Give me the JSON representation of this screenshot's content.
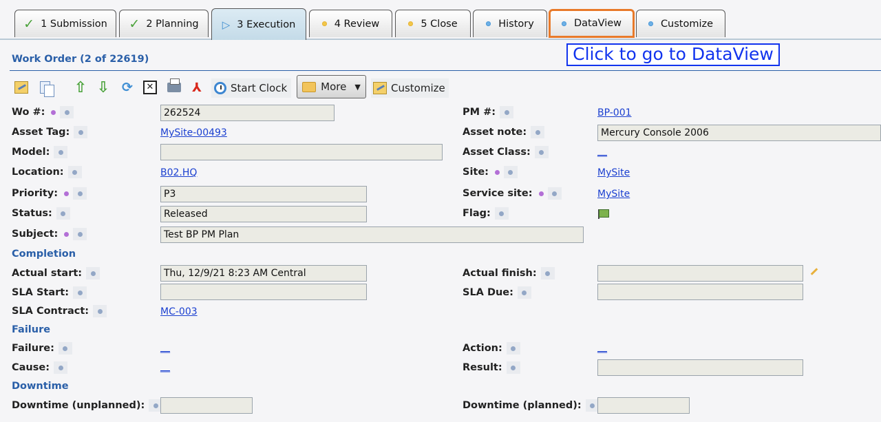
{
  "tabs": [
    {
      "label": "1 Submission",
      "status": "done"
    },
    {
      "label": "2 Planning",
      "status": "done"
    },
    {
      "label": "3 Execution",
      "status": "current"
    },
    {
      "label": "4 Review",
      "status": "pending"
    },
    {
      "label": "5 Close",
      "status": "pending"
    },
    {
      "label": "History",
      "status": "info"
    },
    {
      "label": "DataView",
      "status": "info"
    },
    {
      "label": "Customize",
      "status": "info"
    }
  ],
  "header": {
    "title": "Work Order (2 of 22619)",
    "callout": "Click to go to DataView"
  },
  "toolbar": {
    "start_clock_label": "Start Clock",
    "more_label": "More",
    "customize_label": "Customize"
  },
  "form": {
    "wo_label": "Wo #:",
    "wo_value": "262524",
    "pm_label": "PM #:",
    "pm_value": "BP-001",
    "asset_tag_label": "Asset Tag:",
    "asset_tag_value": "MySite-00493",
    "asset_note_label": "Asset note:",
    "asset_note_value": "Mercury Console 2006",
    "model_label": "Model:",
    "model_value": "",
    "asset_class_label": "Asset Class:",
    "asset_class_value": "__",
    "location_label": "Location:",
    "location_value": "B02.HQ",
    "site_label": "Site:",
    "site_value": "MySite",
    "priority_label": "Priority:",
    "priority_value": "P3",
    "service_site_label": "Service site:",
    "service_site_value": "MySite",
    "status_label": "Status:",
    "status_value": "Released",
    "flag_label": "Flag:",
    "subject_label": "Subject:",
    "subject_value": "Test BP PM Plan"
  },
  "completion": {
    "section": "Completion",
    "actual_start_label": "Actual start:",
    "actual_start_value": "Thu, 12/9/21 8:23 AM Central",
    "actual_finish_label": "Actual finish:",
    "actual_finish_value": "",
    "sla_start_label": "SLA Start:",
    "sla_start_value": "",
    "sla_due_label": "SLA Due:",
    "sla_due_value": "",
    "sla_contract_label": "SLA Contract:",
    "sla_contract_value": "MC-003"
  },
  "failure": {
    "section": "Failure",
    "failure_label": "Failure:",
    "failure_value": "__",
    "action_label": "Action:",
    "action_value": "__",
    "cause_label": "Cause:",
    "cause_value": "__",
    "result_label": "Result:",
    "result_value": ""
  },
  "downtime": {
    "section": "Downtime",
    "unplanned_label": "Downtime (unplanned):",
    "unplanned_value": "",
    "planned_label": "Downtime (planned):",
    "planned_value": ""
  },
  "colors": {
    "section_blue": "#2a5fa8",
    "link_blue": "#1a3fd0",
    "highlight_orange": "#e87a2a",
    "required_dot": "#b36fd6"
  }
}
